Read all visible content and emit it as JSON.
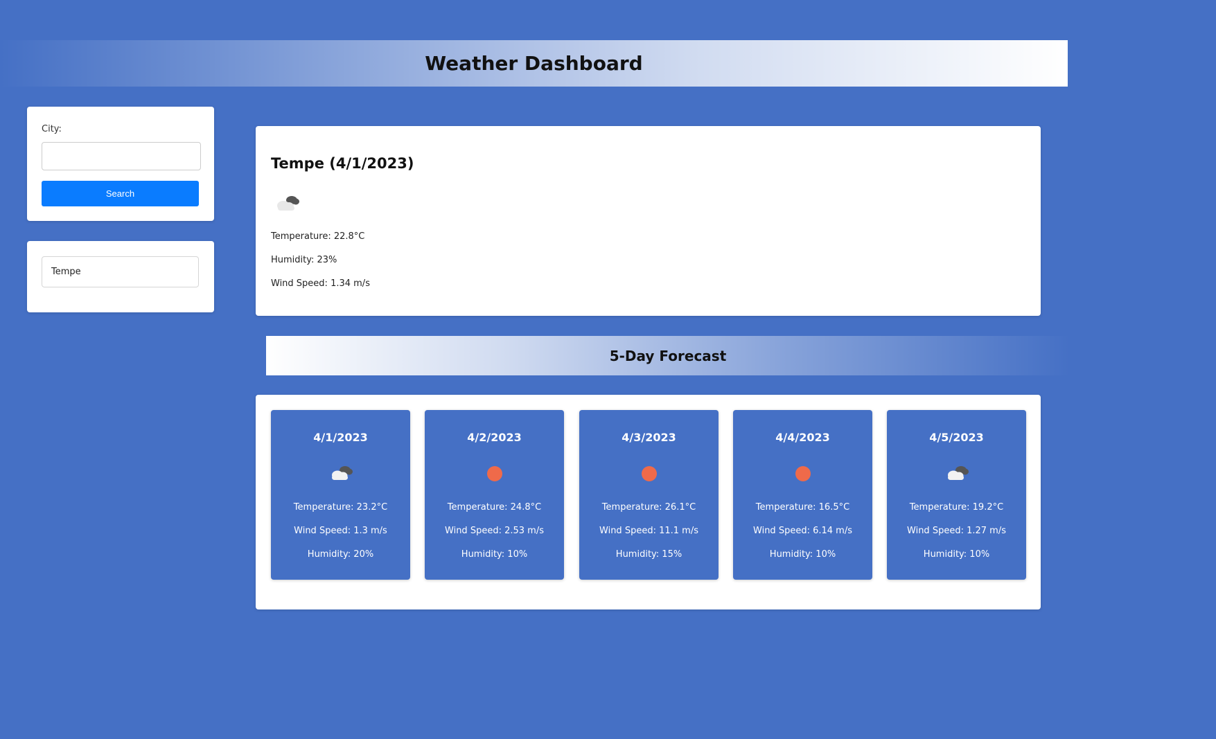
{
  "header": {
    "title": "Weather Dashboard"
  },
  "search": {
    "city_label": "City:",
    "input_value": "",
    "button_label": "Search"
  },
  "history": {
    "items": [
      "Tempe"
    ]
  },
  "current": {
    "title": "Tempe (4/1/2023)",
    "icon": "clouds-icon",
    "temperature": "Temperature: 22.8°C",
    "humidity": "Humidity: 23%",
    "wind": "Wind Speed: 1.34 m/s"
  },
  "forecast": {
    "title": "5-Day Forecast",
    "days": [
      {
        "date": "4/1/2023",
        "icon": "clouds-icon",
        "temperature": "Temperature: 23.2°C",
        "wind": "Wind Speed: 1.3 m/s",
        "humidity": "Humidity: 20%"
      },
      {
        "date": "4/2/2023",
        "icon": "sun-icon",
        "temperature": "Temperature: 24.8°C",
        "wind": "Wind Speed: 2.53 m/s",
        "humidity": "Humidity: 10%"
      },
      {
        "date": "4/3/2023",
        "icon": "sun-icon",
        "temperature": "Temperature: 26.1°C",
        "wind": "Wind Speed: 11.1 m/s",
        "humidity": "Humidity: 15%"
      },
      {
        "date": "4/4/2023",
        "icon": "sun-icon",
        "temperature": "Temperature: 16.5°C",
        "wind": "Wind Speed: 6.14 m/s",
        "humidity": "Humidity: 10%"
      },
      {
        "date": "4/5/2023",
        "icon": "clouds-icon",
        "temperature": "Temperature: 19.2°C",
        "wind": "Wind Speed: 1.27 m/s",
        "humidity": "Humidity: 10%"
      }
    ]
  },
  "colors": {
    "background": "#4570c5",
    "button": "#0a7cff",
    "sun": "#ef6a4a"
  }
}
